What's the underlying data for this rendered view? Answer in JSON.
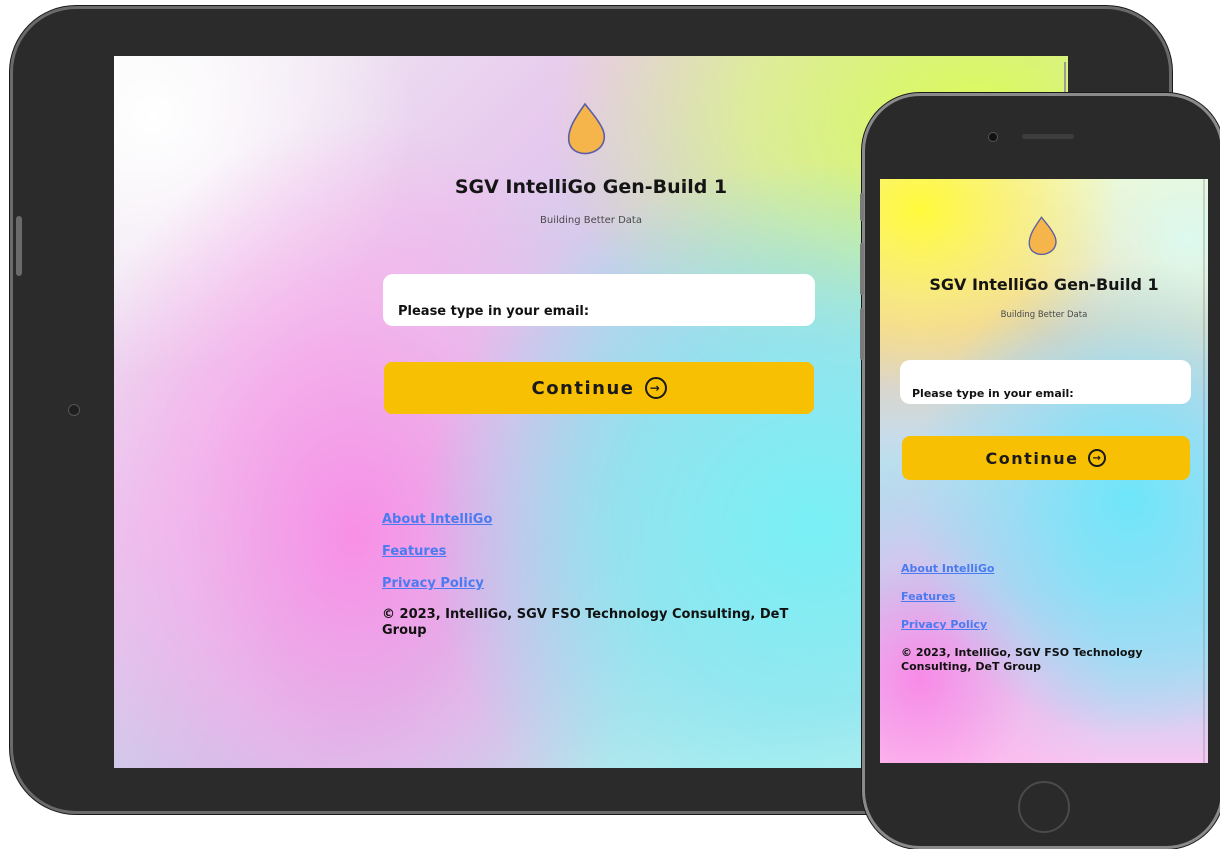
{
  "app": {
    "title": "SGV IntelliGo Gen-Build 1",
    "subtitle": "Building Better Data",
    "email_placeholder": "Please type in your email:",
    "continue_label": "Continue",
    "continue_icon": "arrow-right-circle-icon",
    "logo_icon": "droplet-logo-icon",
    "links": [
      {
        "label": "About IntelliGo"
      },
      {
        "label": "Features"
      },
      {
        "label": "Privacy Policy"
      }
    ],
    "copyright": "© 2023, IntelliGo, SGV FSO Technology Consulting, DeT Group"
  },
  "colors": {
    "button": "#f8c003",
    "link": "#4a7bf0",
    "logo_fill": "#f6b54a",
    "logo_outline": "#5a5fa8",
    "device_frame": "#2b2b2b"
  }
}
